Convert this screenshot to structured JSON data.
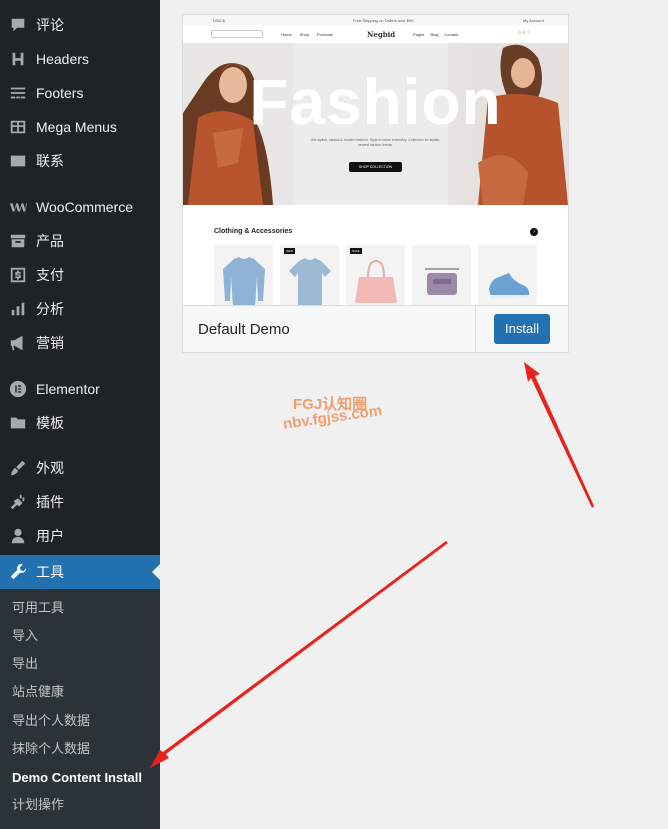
{
  "sidebar": {
    "items": [
      {
        "label": "评论",
        "icon": "comment-icon"
      },
      {
        "label": "Headers",
        "icon": "heading-icon"
      },
      {
        "label": "Footers",
        "icon": "footer-icon"
      },
      {
        "label": "Mega Menus",
        "icon": "table-icon"
      },
      {
        "label": "联系",
        "icon": "mail-icon"
      },
      {
        "label": "WooCommerce",
        "icon": "woocommerce-icon"
      },
      {
        "label": "产品",
        "icon": "archive-icon"
      },
      {
        "label": "支付",
        "icon": "money-icon"
      },
      {
        "label": "分析",
        "icon": "bar-chart-icon"
      },
      {
        "label": "营销",
        "icon": "megaphone-icon"
      },
      {
        "label": "Elementor",
        "icon": "elementor-icon"
      },
      {
        "label": "模板",
        "icon": "folder-icon"
      },
      {
        "label": "外观",
        "icon": "paintbrush-icon"
      },
      {
        "label": "插件",
        "icon": "plugin-icon"
      },
      {
        "label": "用户",
        "icon": "user-icon"
      },
      {
        "label": "工具",
        "icon": "wrench-icon"
      }
    ],
    "submenu": [
      {
        "label": "可用工具"
      },
      {
        "label": "导入"
      },
      {
        "label": "导出"
      },
      {
        "label": "站点健康"
      },
      {
        "label": "导出个人数据"
      },
      {
        "label": "抹除个人数据"
      },
      {
        "label": "Demo Content Install"
      },
      {
        "label": "计划操作"
      }
    ]
  },
  "demo": {
    "name": "Default Demo",
    "install_label": "Install",
    "preview": {
      "hero_title": "Fashion",
      "section_title": "Clothing & Accessories",
      "logo": "Negbid"
    }
  },
  "watermark": {
    "line1": "FGJ认知圈",
    "line2": "nbv.fgjss.com"
  },
  "colors": {
    "sidebar_bg": "#1d2327",
    "submenu_bg": "#2c3338",
    "accent": "#2271b1",
    "arrow": "#e8231d"
  }
}
